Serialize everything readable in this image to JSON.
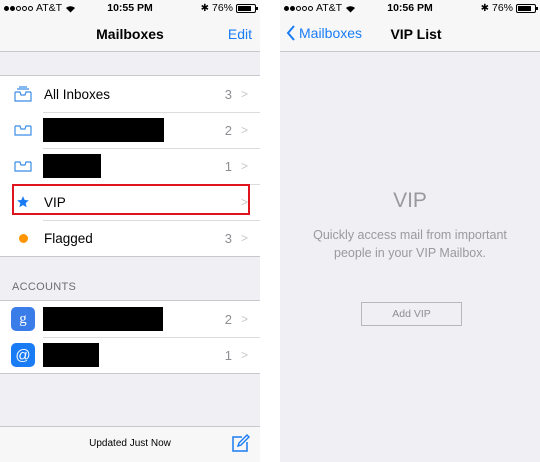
{
  "left": {
    "status": {
      "carrier": "AT&T",
      "time": "10:55 PM",
      "battery": "76%"
    },
    "nav": {
      "title": "Mailboxes",
      "edit": "Edit"
    },
    "mailboxes": [
      {
        "label": "All Inboxes",
        "count": "3",
        "icon": "inbox-tray-icon"
      },
      {
        "label": "",
        "count": "2",
        "icon": "inbox-tray-icon",
        "redacted": true
      },
      {
        "label": "",
        "count": "1",
        "icon": "inbox-tray-icon",
        "redacted": true
      },
      {
        "label": "VIP",
        "count": "",
        "icon": "star-icon"
      },
      {
        "label": "Flagged",
        "count": "3",
        "icon": "orange-dot-icon"
      }
    ],
    "accounts_header": "ACCOUNTS",
    "accounts": [
      {
        "label": "",
        "count": "2",
        "icon": "google-icon",
        "redacted": true
      },
      {
        "label": "",
        "count": "1",
        "icon": "at-sign-icon",
        "redacted": true
      }
    ],
    "toolbar": {
      "updated": "Updated Just Now"
    }
  },
  "right": {
    "status": {
      "carrier": "AT&T",
      "time": "10:56 PM",
      "battery": "76%"
    },
    "nav": {
      "back": "Mailboxes",
      "title": "VIP List"
    },
    "vip_title": "VIP",
    "vip_desc": "Quickly access mail from important people in your VIP Mailbox.",
    "add_vip": "Add VIP"
  },
  "colors": {
    "accent": "#1a7cf5",
    "highlight": "#e0141e",
    "flag": "#ff9500",
    "google": "#3b7de8"
  }
}
